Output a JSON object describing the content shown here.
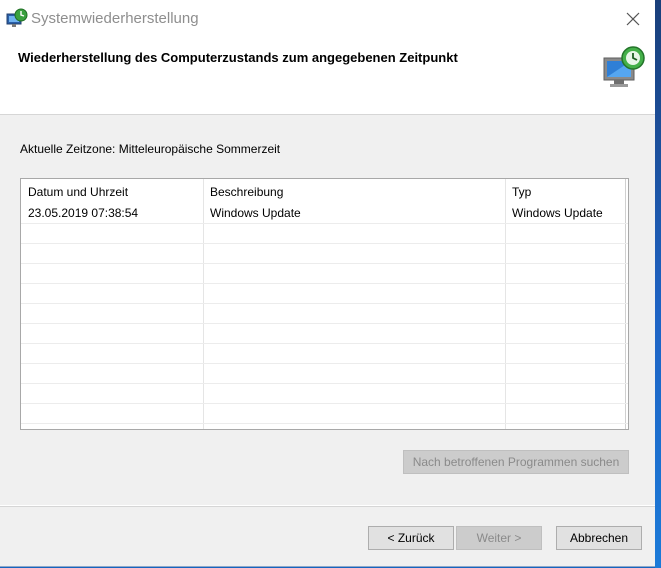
{
  "window": {
    "title": "Systemwiederherstellung",
    "header_title": "Wiederherstellung des Computerzustands zum angegebenen Zeitpunkt"
  },
  "timezone": {
    "text": "Aktuelle Zeitzone: Mitteleuropäische Sommerzeit"
  },
  "table": {
    "columns": [
      "Datum und Uhrzeit",
      "Beschreibung",
      "Typ"
    ],
    "rows": [
      [
        "23.05.2019 07:38:54",
        "Windows Update",
        "Windows Update"
      ]
    ]
  },
  "buttons": {
    "scan": "Nach betroffenen Programmen suchen",
    "back": "< Zurück",
    "next": "Weiter >",
    "cancel": "Abbrechen"
  },
  "icons": {
    "title": "system-restore-icon",
    "header": "system-restore-monitor-icon",
    "close": "close-icon"
  },
  "colors": {
    "accent": "#1565c0",
    "disabled_text": "#8a8a8a"
  }
}
